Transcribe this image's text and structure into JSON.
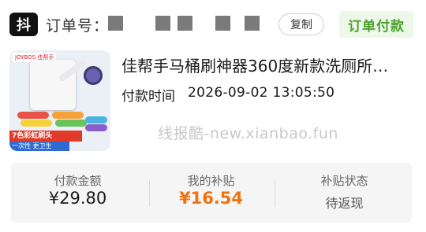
{
  "header": {
    "platform_badge": "抖",
    "order_label": "订单号：",
    "copy_button": "复制",
    "status": "订单付款",
    "status_color": "#4aa32c"
  },
  "product": {
    "title": "佳帮手马桶刷神器360度新款洗厕所…",
    "image": {
      "brand": "JOYBOS 佳帮手",
      "promo_line1": "7色彩虹刷头",
      "promo_line2": "一次性 更卫生"
    },
    "pay_time_label": "付款时间",
    "pay_time": "2026-09-02 13:05:50"
  },
  "watermark": "线报酷-new.xianbao.fun",
  "stats": [
    {
      "label": "付款金额",
      "value": "¥29.80"
    },
    {
      "label": "我的补贴",
      "value": "¥16.54",
      "color": "#f0720f"
    },
    {
      "label": "补贴状态",
      "value": "待返现"
    }
  ]
}
